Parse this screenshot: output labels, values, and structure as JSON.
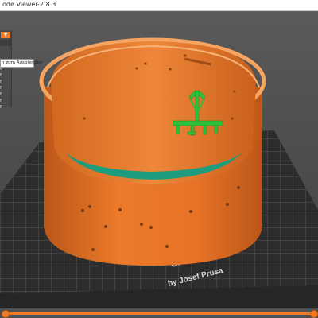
{
  "window": {
    "title": "ode Viewer-2.8.3"
  },
  "legend": {
    "rows": [
      "",
      "g",
      "g",
      "g",
      "g",
      "g",
      "g",
      "g",
      "g",
      "g",
      "g",
      "g"
    ]
  },
  "tooltip": {
    "text": "n zum Ausblenden"
  },
  "bed": {
    "brand_model": "SA i3 MK3",
    "brand_by": "by Josef Prusa"
  },
  "slider": {
    "progress_fraction": 1.0
  },
  "colors": {
    "print_orange": "#ee7c2b",
    "print_orange_dark": "#c8611a",
    "support_green": "#2fbf3a",
    "brim_teal": "#1e9c7e",
    "bed_dark": "#2d2d2d",
    "bed_grid": "#4a4a4a",
    "background": "#4a4a4a",
    "accent": "#ef7d28"
  }
}
